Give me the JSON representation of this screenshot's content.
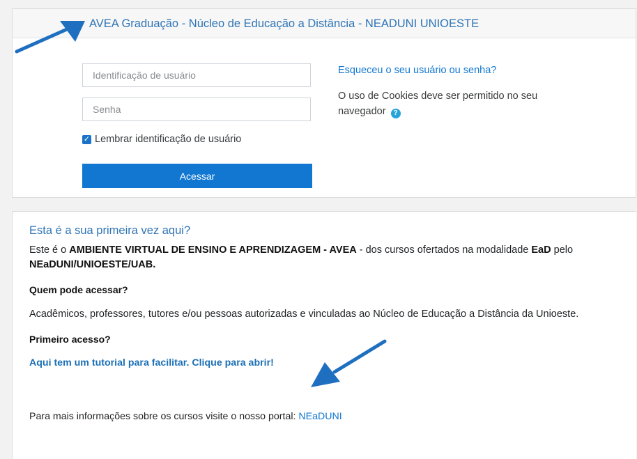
{
  "login": {
    "title": "AVEA Graduação - Núcleo de Educação a Distância - NEADUNI UNIOESTE",
    "username_placeholder": "Identificação de usuário",
    "password_placeholder": "Senha",
    "remember_label": "Lembrar identificação de usuário",
    "remember_checked": true,
    "submit_label": "Acessar",
    "forgot_link": "Esqueceu o seu usuário ou senha?",
    "cookies_note": "O uso de Cookies deve ser permitido no seu navegador",
    "help_icon": "question-circle-icon"
  },
  "info": {
    "title": "Esta é a sua primeira vez aqui?",
    "intro_1": "Este é o ",
    "intro_bold_1": "AMBIENTE VIRTUAL DE ENSINO E APRENDIZAGEM - AVEA",
    "intro_2": " - dos cursos ofertados na modalidade ",
    "intro_bold_2": "EaD",
    "intro_3": " pelo ",
    "intro_bold_3": "NEaDUNI/UNIOESTE/UAB.",
    "who_heading": "Quem pode acessar?",
    "who_text": "Acadêmicos, professores, tutores e/ou pessoas autorizadas e vinculadas ao Núcleo de Educação a Distância da Unioeste.",
    "first_access_heading": "Primeiro acesso?",
    "tutorial_link": "Aqui tem um tutorial para facilitar. Clique para abrir!",
    "portal_text": "Para mais informações sobre os cursos visite o nosso portal: ",
    "portal_link": "NEaDUNI"
  },
  "annotations": {
    "arrow_color": "#1f6fc0",
    "arrow_icons": [
      "arrow-pointing-title-icon",
      "arrow-pointing-tutorial-icon"
    ]
  },
  "colors": {
    "accent": "#1177d1",
    "heading_blue": "#2e74b6",
    "page_bg": "#f2f2f2"
  }
}
